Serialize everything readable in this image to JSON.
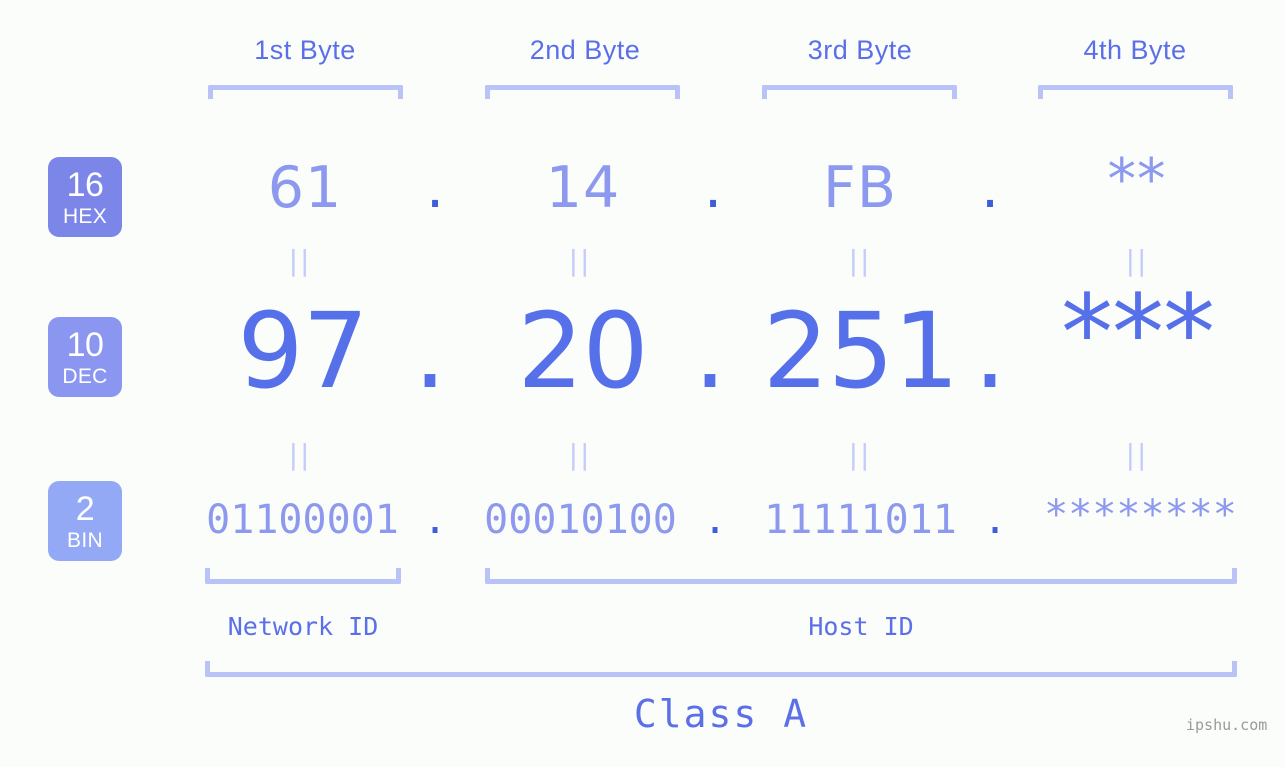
{
  "page": {
    "background_color": "#fbfdfa",
    "accent_color": "#5b6fe8",
    "bracket_color": "#b9c3f7",
    "watermark": "ipshu.com"
  },
  "byte_headers": [
    {
      "label": "1st Byte"
    },
    {
      "label": "2nd Byte"
    },
    {
      "label": "3rd Byte"
    },
    {
      "label": "4th Byte"
    }
  ],
  "rows": [
    {
      "badge": {
        "number": "16",
        "name": "HEX",
        "color": "#7b86e8"
      },
      "values": [
        "61",
        "14",
        "FB",
        "**"
      ],
      "separator": "."
    },
    {
      "badge": {
        "number": "10",
        "name": "DEC",
        "color": "#8b96f0"
      },
      "values": [
        "97",
        "20",
        "251",
        "***"
      ],
      "separator": "."
    },
    {
      "badge": {
        "number": "2",
        "name": "BIN",
        "color": "#93a9f5"
      },
      "values": [
        "01100001",
        "00010100",
        "11111011",
        "********"
      ],
      "separator": "."
    }
  ],
  "equals_marks": [
    "||",
    "||",
    "||",
    "||"
  ],
  "id_sections": [
    {
      "label": "Network ID"
    },
    {
      "label": "Host ID"
    }
  ],
  "class_section": {
    "label": "Class A"
  }
}
